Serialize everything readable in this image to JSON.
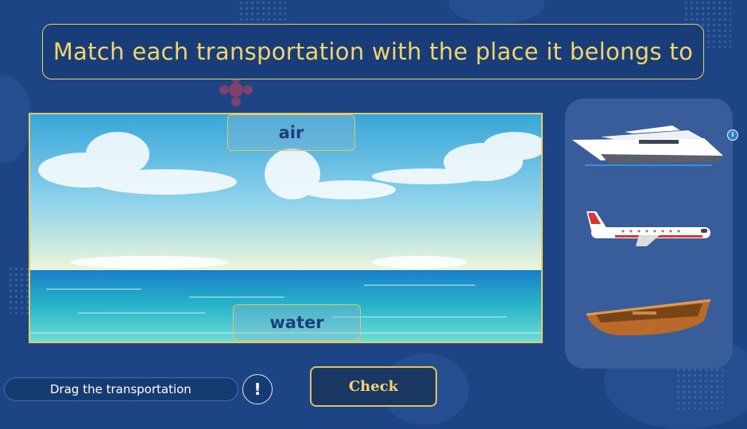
{
  "title": "Match each transportation with the place it belongs to",
  "drop_zones": {
    "air": "air",
    "water": "water"
  },
  "vehicles": [
    {
      "name": "yacht",
      "icon": "yacht-icon"
    },
    {
      "name": "airplane",
      "icon": "airplane-icon"
    },
    {
      "name": "rowboat",
      "icon": "rowboat-icon"
    }
  ],
  "footer": {
    "hint": "Drag the transportation",
    "alert_symbol": "!",
    "check_label": "Check"
  },
  "colors": {
    "background": "#1d4585",
    "accent": "#f3d667",
    "panel": "#3a5f9b"
  }
}
